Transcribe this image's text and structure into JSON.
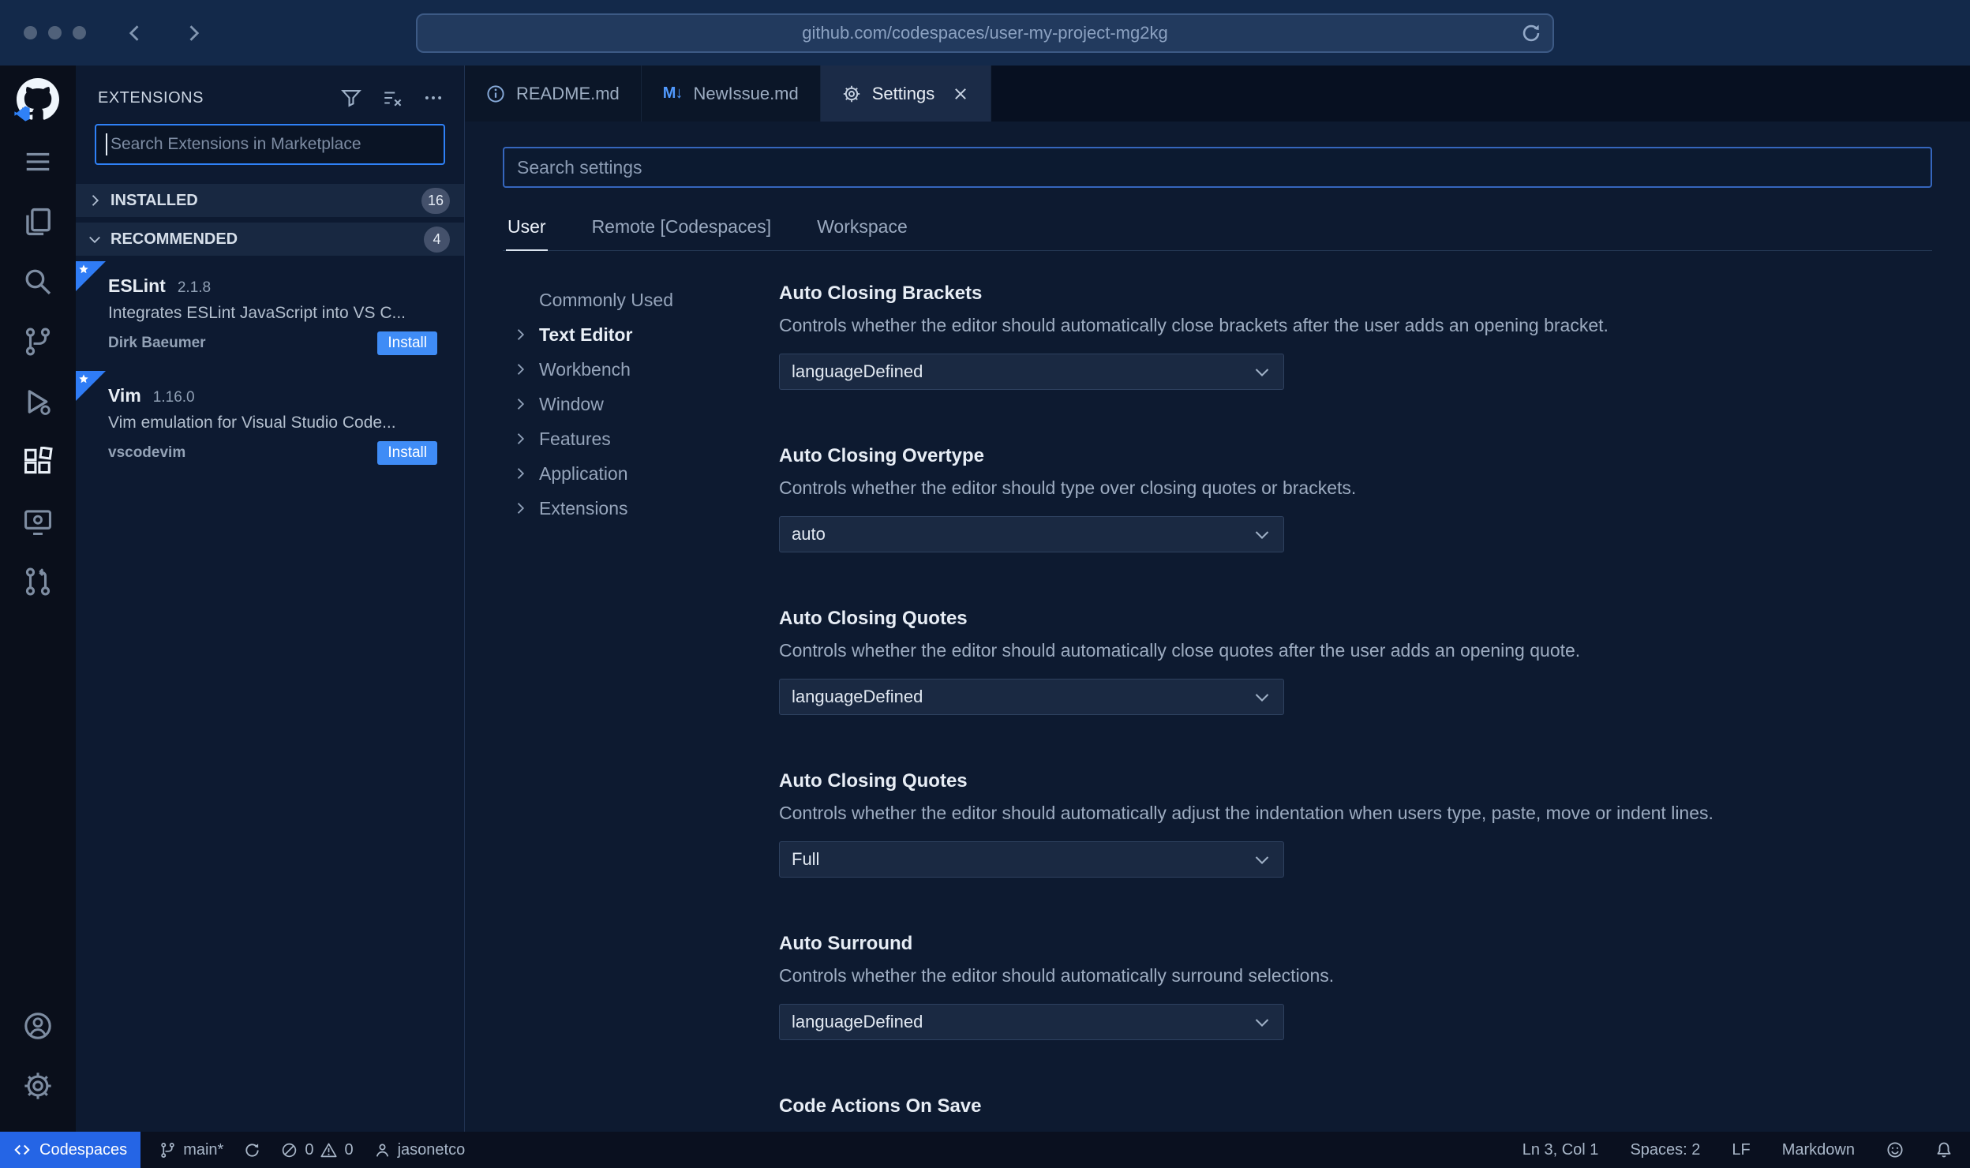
{
  "browser": {
    "url": "github.com/codespaces/user-my-project-mg2kg"
  },
  "sidebar": {
    "title": "EXTENSIONS",
    "search_placeholder": "Search Extensions in Marketplace",
    "sections": [
      {
        "label": "INSTALLED",
        "badge": "16"
      },
      {
        "label": "RECOMMENDED",
        "badge": "4"
      }
    ],
    "extensions": [
      {
        "name": "ESLint",
        "version": "2.1.8",
        "description": "Integrates ESLint JavaScript into VS C...",
        "author": "Dirk Baeumer",
        "action": "Install"
      },
      {
        "name": "Vim",
        "version": "1.16.0",
        "description": "Vim emulation for Visual Studio Code...",
        "author": "vscodevim",
        "action": "Install"
      }
    ]
  },
  "tabs": [
    {
      "label": "README.md"
    },
    {
      "label": "NewIssue.md",
      "icon_label": "M↓"
    },
    {
      "label": "Settings"
    }
  ],
  "settings_editor": {
    "search_placeholder": "Search settings",
    "scopes": [
      {
        "label": "User"
      },
      {
        "label": "Remote [Codespaces]"
      },
      {
        "label": "Workspace"
      }
    ],
    "toc": [
      {
        "label": "Commonly Used"
      },
      {
        "label": "Text Editor"
      },
      {
        "label": "Workbench"
      },
      {
        "label": "Window"
      },
      {
        "label": "Features"
      },
      {
        "label": "Application"
      },
      {
        "label": "Extensions"
      }
    ],
    "items": [
      {
        "title": "Auto Closing Brackets",
        "description": "Controls whether the editor should automatically close brackets after the user adds an opening bracket.",
        "value": "languageDefined"
      },
      {
        "title": "Auto Closing Overtype",
        "description": "Controls whether the editor should type over closing quotes or brackets.",
        "value": "auto"
      },
      {
        "title": "Auto Closing Quotes",
        "description": "Controls whether the editor should automatically close quotes after the user adds an opening quote.",
        "value": "languageDefined"
      },
      {
        "title": "Auto Closing Quotes",
        "description": "Controls whether the editor should automatically adjust the indentation when users type, paste, move or indent lines.",
        "value": "Full"
      },
      {
        "title": "Auto Surround",
        "description": "Controls whether the editor should automatically surround selections.",
        "value": "languageDefined"
      },
      {
        "title": "Code Actions On Save"
      }
    ]
  },
  "status_bar": {
    "codespaces_label": "Codespaces",
    "branch": "main*",
    "errors": "0",
    "warnings": "0",
    "user": "jasonetco",
    "line_col": "Ln 3, Col 1",
    "indentation": "Spaces: 2",
    "eol": "LF",
    "language": "Markdown"
  }
}
